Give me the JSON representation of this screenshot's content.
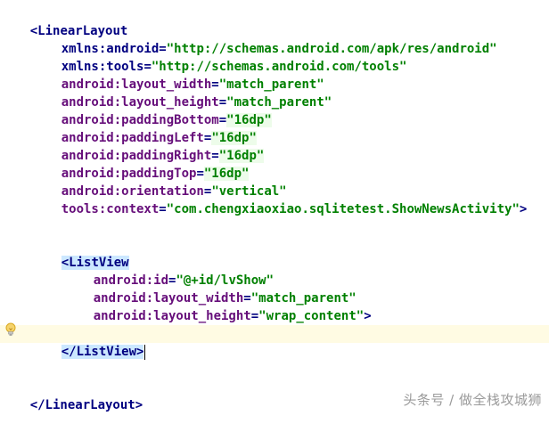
{
  "editor": {
    "lines": {
      "l1": {
        "open": "<",
        "tag": "LinearLayout"
      },
      "l2": {
        "attr": "xmlns:android",
        "value": "\"http://schemas.android.com/apk/res/android\""
      },
      "l3": {
        "attr": "xmlns:tools",
        "value": "\"http://schemas.android.com/tools\""
      },
      "l4": {
        "attr": "android:layout_width",
        "value": "\"match_parent\""
      },
      "l5": {
        "attr": "android:layout_height",
        "value": "\"match_parent\""
      },
      "l6": {
        "attr": "android:paddingBottom",
        "value": "\"16dp\""
      },
      "l7": {
        "attr": "android:paddingLeft",
        "value": "\"16dp\""
      },
      "l8": {
        "attr": "android:paddingRight",
        "value": "\"16dp\""
      },
      "l9": {
        "attr": "android:paddingTop",
        "value": "\"16dp\""
      },
      "l10": {
        "attr": "android:orientation",
        "value": "\"vertical\""
      },
      "l11": {
        "attr": "tools:context",
        "value": "\"com.chengxiaoxiao.sqlitetest.ShowNewsActivity\"",
        "close": ">"
      },
      "l12": {
        "open": "<",
        "tag": "ListView"
      },
      "l13": {
        "attr": "android:id",
        "value": "\"@+id/lvShow\""
      },
      "l14": {
        "attr": "android:layout_width",
        "value": "\"match_parent\""
      },
      "l15": {
        "attr": "android:layout_height",
        "value": "\"wrap_content\"",
        "close": ">"
      },
      "l16": {
        "text": "</ListView>"
      },
      "l17": {
        "text": "</LinearLayout>"
      }
    },
    "eq": "="
  },
  "watermark": {
    "text": "头条号 / 做全栈攻城狮"
  },
  "icons": {
    "intention": "lightbulb-icon"
  },
  "colors": {
    "tag": "#000080",
    "attribute": "#660e7a",
    "value": "#008000",
    "current_line": "#fffbe3",
    "tag_highlight": "#cce8ff"
  }
}
